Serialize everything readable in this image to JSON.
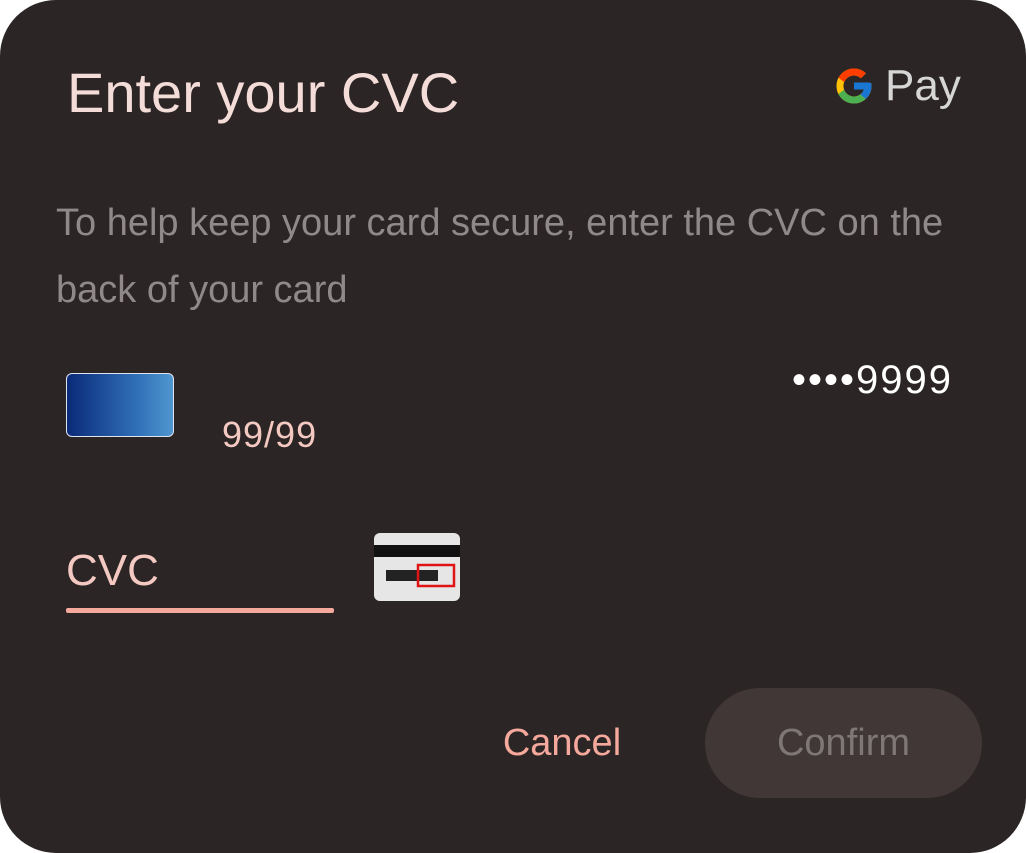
{
  "dialog": {
    "title": "Enter your CVC",
    "description": "To help keep your card secure, enter the CVC on the back of your card"
  },
  "brand": {
    "name": "Pay",
    "icon": "google-g-icon"
  },
  "card": {
    "expiry": "99/99",
    "masked_number": "••••9999",
    "icon": "credit-card-icon"
  },
  "cvc_input": {
    "placeholder": "CVC",
    "value": "",
    "hint_icon": "card-back-cvc-icon"
  },
  "buttons": {
    "cancel": "Cancel",
    "confirm": "Confirm"
  },
  "colors": {
    "background": "#2c2525",
    "accent": "#f4a99c",
    "title": "#f4ddd9",
    "disabled_button": "#403736"
  }
}
